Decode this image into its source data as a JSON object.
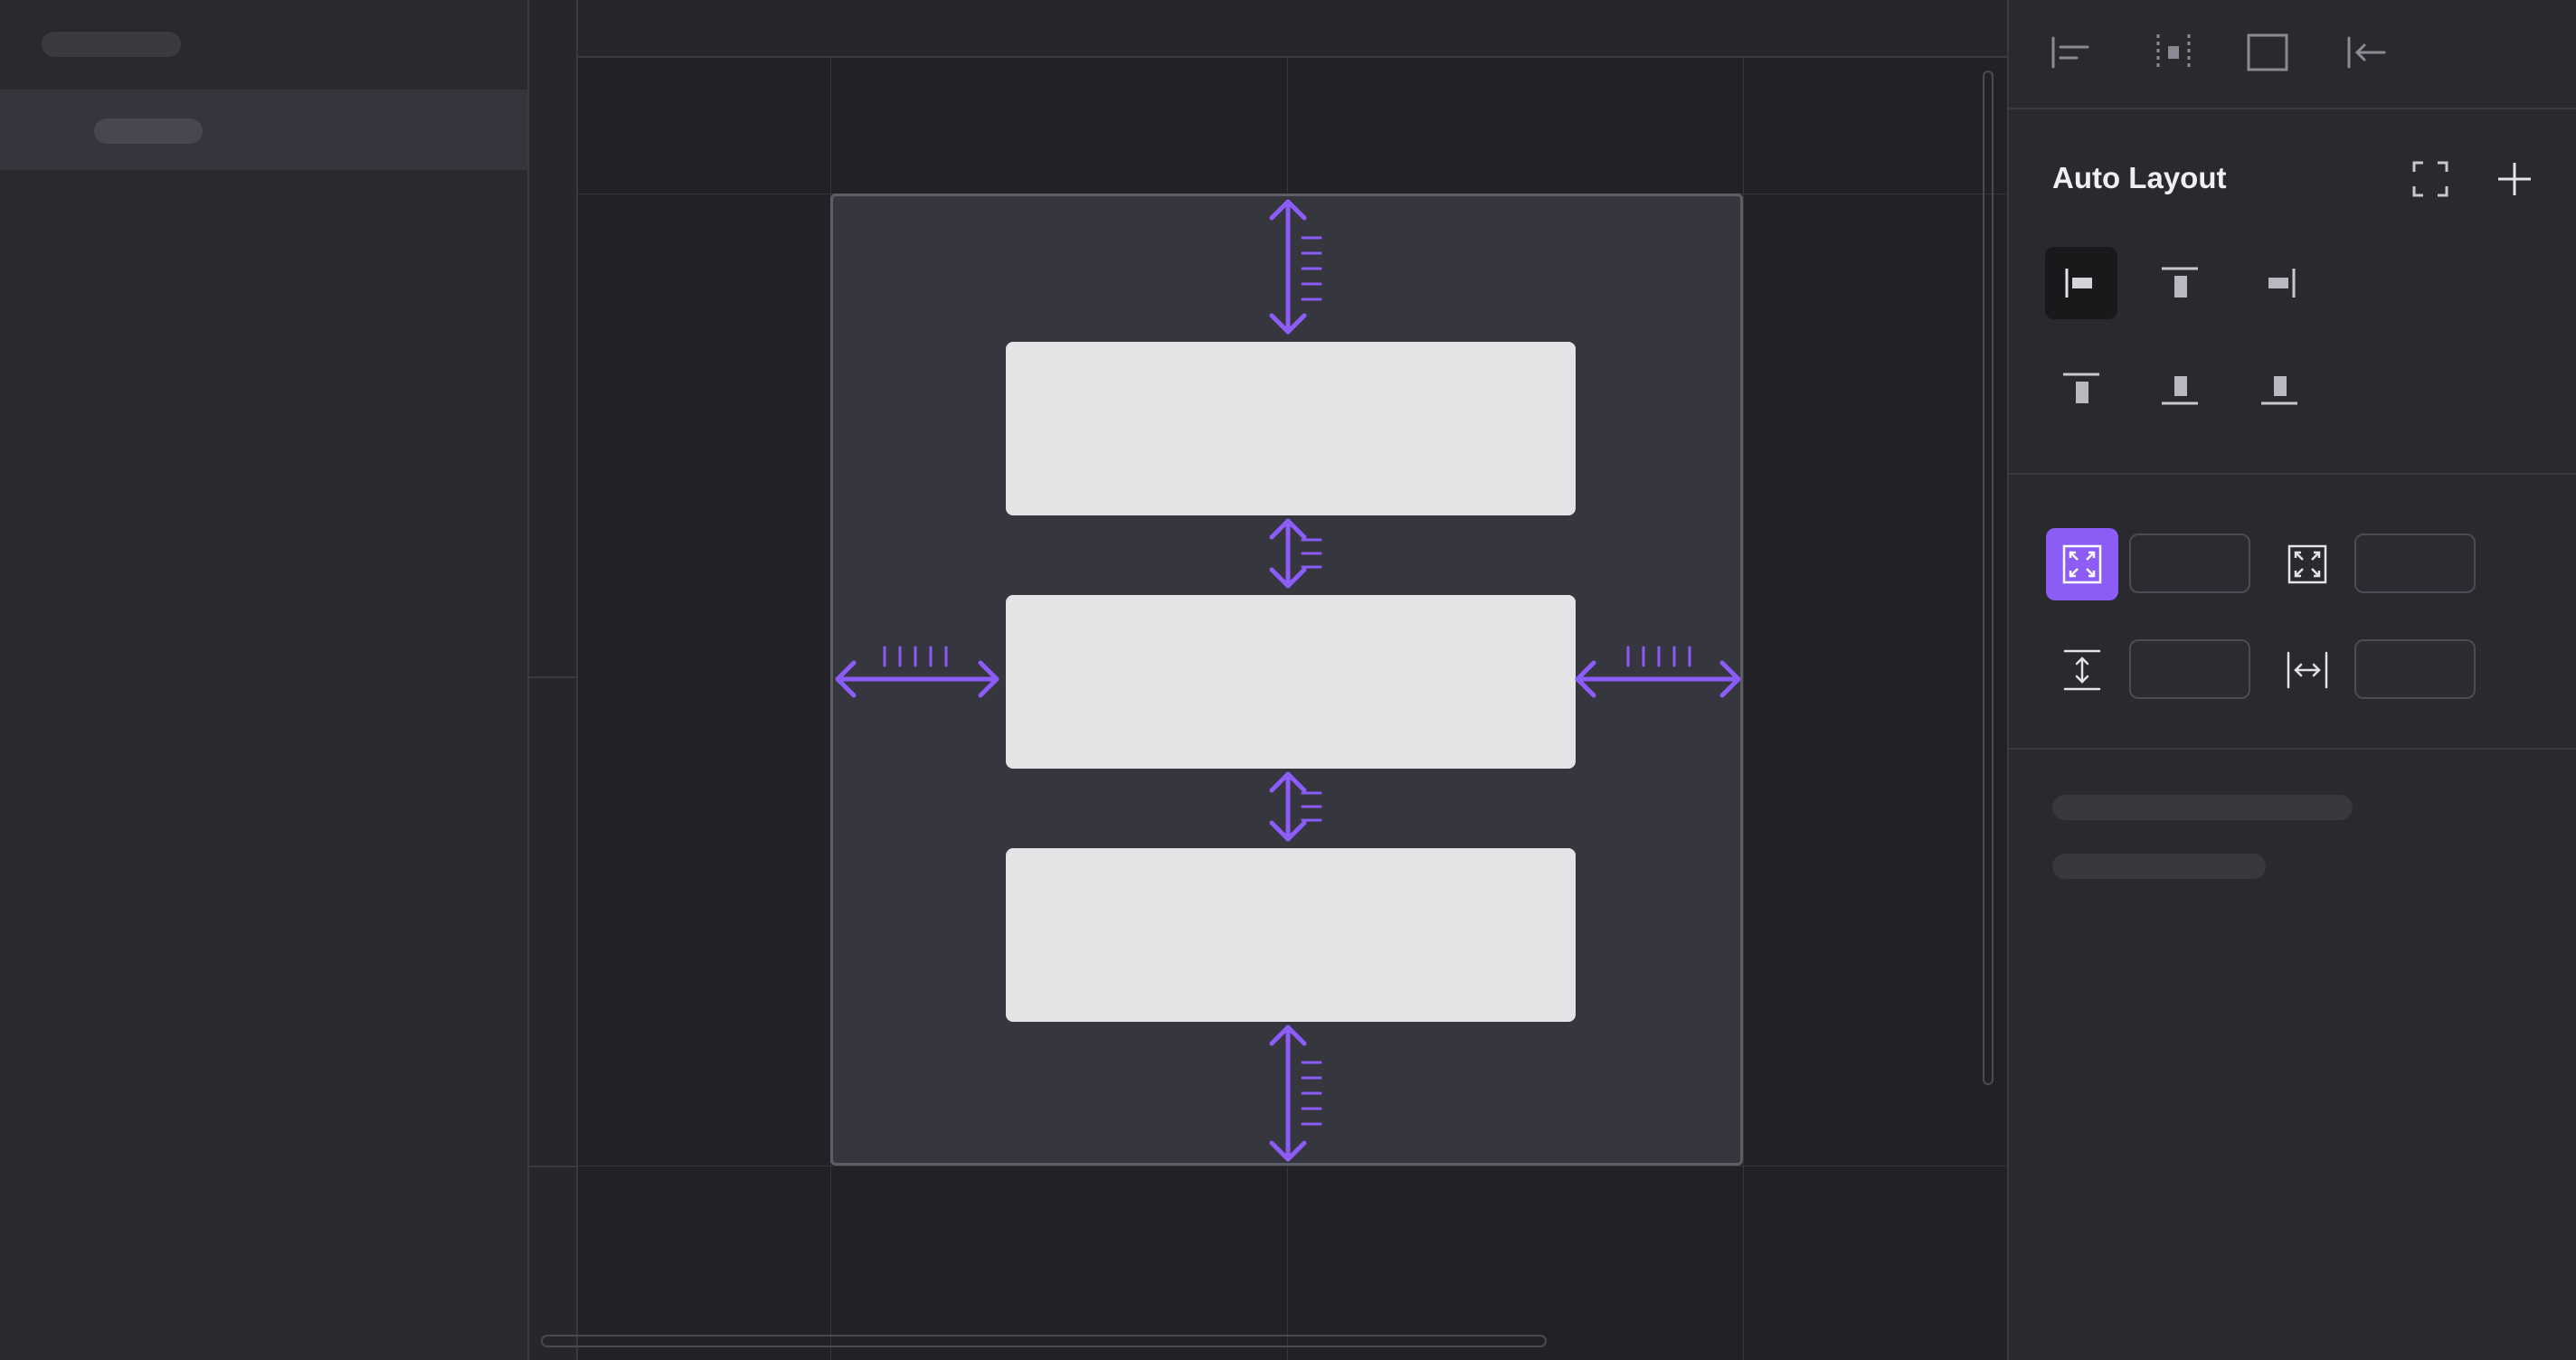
{
  "colors": {
    "accent": "#8b5cf6",
    "panel_bg": "#29292e",
    "canvas_bg": "#222226",
    "frame_bg": "#36363f",
    "child_bg": "#e4e4e7"
  },
  "toolbar": {
    "icons": [
      "align-left-icon",
      "distribute-icon",
      "frame-icon",
      "collapse-left-icon"
    ]
  },
  "auto_layout": {
    "title": "Auto Layout",
    "header_icons": [
      "resize-to-fit-icon",
      "add-icon"
    ],
    "alignment_row1": [
      "align-left-icon",
      "align-center-icon",
      "align-right-icon"
    ],
    "alignment_row2": [
      "align-top-icon",
      "align-middle-icon",
      "align-bottom-icon"
    ],
    "selected_alignment": "align-left-icon",
    "padding_row": {
      "icons": [
        "padding-all-icon",
        "padding-individual-icon"
      ],
      "values": [
        "",
        ""
      ]
    },
    "spacing_row": {
      "icons": [
        "vertical-spacing-icon",
        "horizontal-spacing-icon"
      ],
      "values": [
        "",
        ""
      ]
    }
  },
  "canvas": {
    "children_count": 3
  }
}
